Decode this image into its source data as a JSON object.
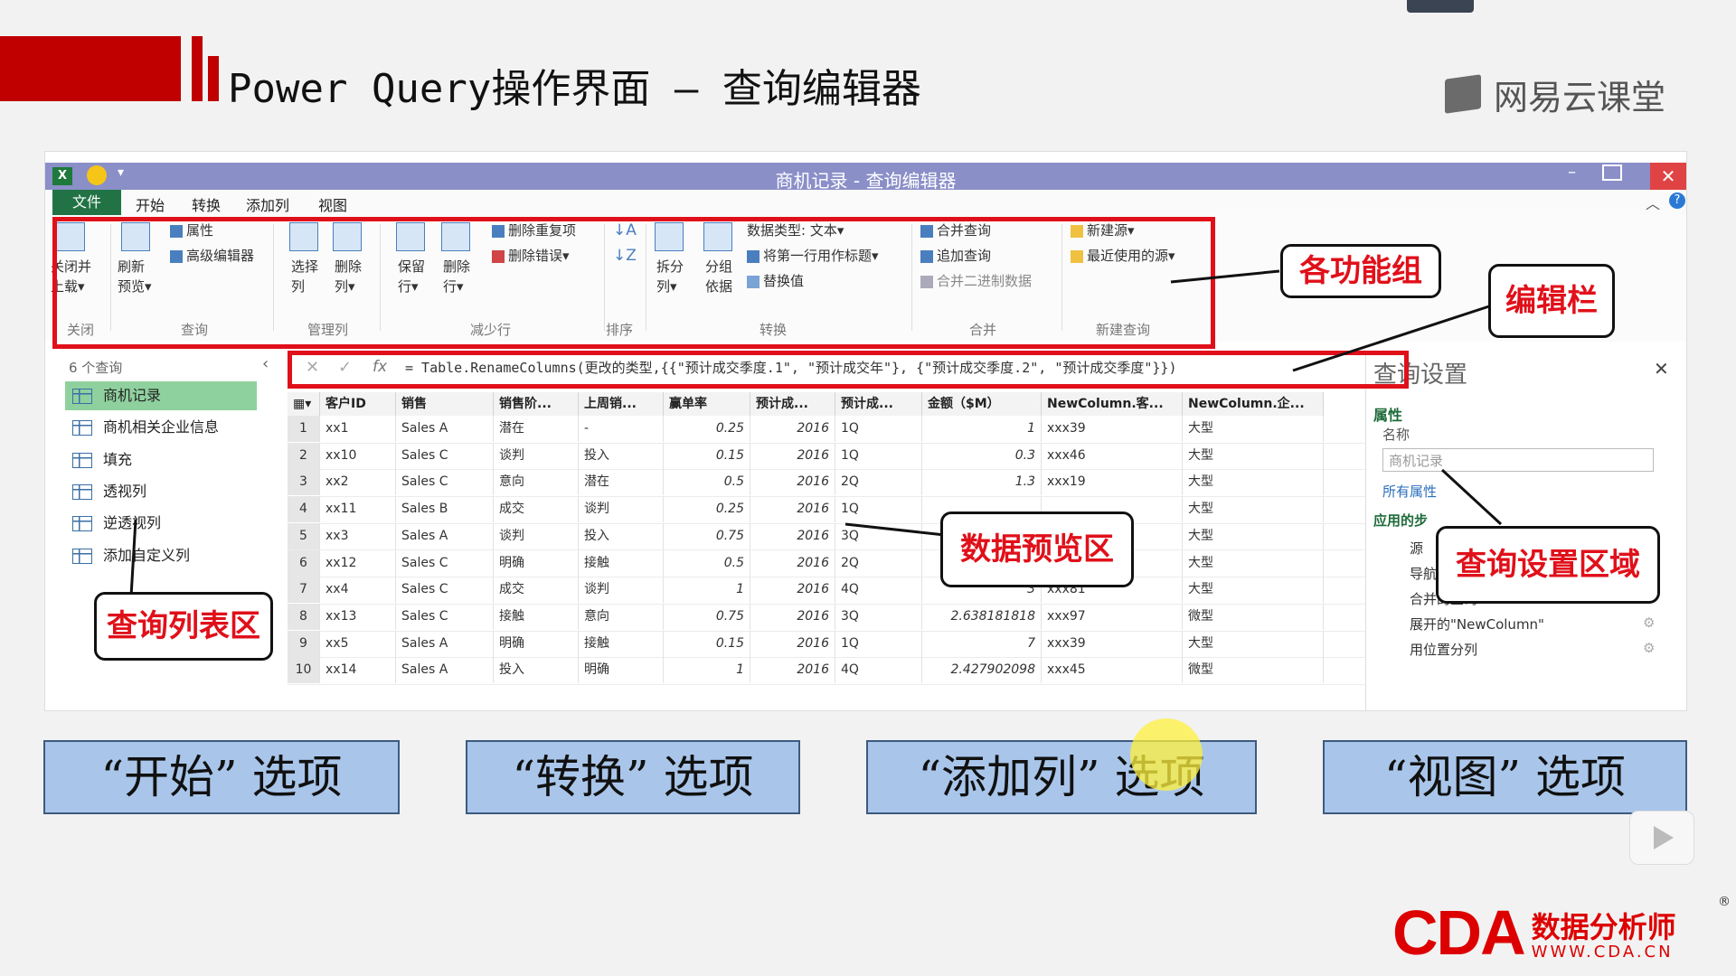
{
  "slide": {
    "title": "Power Query操作界面 – 查询编辑器",
    "brand": "网易云课堂",
    "footer_logo": "CDA",
    "footer_cn": "数据分析师",
    "footer_url": "WWW.CDA.CN",
    "registered": "®"
  },
  "window": {
    "title": "商机记录 - 查询编辑器",
    "xl_icon": "X",
    "min": "–",
    "close": "✕"
  },
  "menu": {
    "file": "文件",
    "items": [
      "开始",
      "转换",
      "添加列",
      "视图"
    ]
  },
  "ribbon": {
    "close_load": "关闭并",
    "close_load2": "上载▾",
    "refresh": "刷新",
    "refresh2": "预览▾",
    "properties": "属性",
    "advanced_editor": "高级编辑器",
    "choose_cols": "选择",
    "choose_cols2": "列",
    "remove_cols": "删除",
    "remove_cols2": "列▾",
    "keep_rows": "保留",
    "keep_rows2": "行▾",
    "remove_rows": "删除",
    "remove_rows2": "行▾",
    "remove_dup": "删除重复项",
    "remove_err": "删除错误▾",
    "split_col": "拆分",
    "split_col2": "列▾",
    "group_by": "分组",
    "group_by2": "依据",
    "data_type": "数据类型: 文本▾",
    "first_row_header": "将第一行用作标题▾",
    "replace": "替换值",
    "merge_queries": "合并查询",
    "append_queries": "追加查询",
    "combine_binaries": "合并二进制数据",
    "new_source": "新建源▾",
    "recent_sources": "最近使用的源▾",
    "groups": [
      "关闭",
      "查询",
      "管理列",
      "减少行",
      "排序",
      "转换",
      "合并",
      "新建查询"
    ]
  },
  "queries": {
    "count": "6 个查询",
    "collapse": "‹",
    "items": [
      "商机记录",
      "商机相关企业信息",
      "填充",
      "透视列",
      "逆透视列",
      "添加自定义列"
    ]
  },
  "formula": {
    "cancel": "✕",
    "confirm": "✓",
    "fx": "fx",
    "text": "= Table.RenameColumns(更改的类型,{{\"预计成交季度.1\", \"预计成交年\"}, {\"预计成交季度.2\", \"预计成交季度\"}})"
  },
  "grid": {
    "headers": [
      "客户ID",
      "销售",
      "销售阶...",
      "上周销...",
      "赢单率",
      "预计成...",
      "预计成...",
      "金额（$M）",
      "NewColumn.客...",
      "NewColumn.企..."
    ],
    "rows": [
      [
        "1",
        "xx1",
        "Sales A",
        "潜在",
        "-",
        "0.25",
        "2016",
        "1Q",
        "1",
        "xxx39",
        "大型"
      ],
      [
        "2",
        "xx10",
        "Sales C",
        "谈判",
        "投入",
        "0.15",
        "2016",
        "1Q",
        "0.3",
        "xxx46",
        "大型"
      ],
      [
        "3",
        "xx2",
        "Sales C",
        "意向",
        "潜在",
        "0.5",
        "2016",
        "2Q",
        "1.3",
        "xxx19",
        "大型"
      ],
      [
        "4",
        "xx11",
        "Sales B",
        "成交",
        "谈判",
        "0.25",
        "2016",
        "1Q",
        "",
        "",
        "大型"
      ],
      [
        "5",
        "xx3",
        "Sales A",
        "谈判",
        "投入",
        "0.75",
        "2016",
        "3Q",
        "",
        "",
        "大型"
      ],
      [
        "6",
        "xx12",
        "Sales C",
        "明确",
        "接触",
        "0.5",
        "2016",
        "2Q",
        "",
        "",
        "大型"
      ],
      [
        "7",
        "xx4",
        "Sales C",
        "成交",
        "谈判",
        "1",
        "2016",
        "4Q",
        "3",
        "xxx81",
        "大型"
      ],
      [
        "8",
        "xx13",
        "Sales C",
        "接触",
        "意向",
        "0.75",
        "2016",
        "3Q",
        "2.638181818",
        "xxx97",
        "微型"
      ],
      [
        "9",
        "xx5",
        "Sales A",
        "明确",
        "接触",
        "0.15",
        "2016",
        "1Q",
        "7",
        "xxx39",
        "大型"
      ],
      [
        "10",
        "xx14",
        "Sales A",
        "投入",
        "明确",
        "1",
        "2016",
        "4Q",
        "2.427902098",
        "xxx45",
        "微型"
      ]
    ]
  },
  "settings": {
    "title": "查询设置",
    "close": "✕",
    "properties": "属性",
    "name_label": "名称",
    "name_value": "商机记录",
    "all_properties": "所有属性",
    "applied_steps": "应用的步",
    "steps": [
      "源",
      "导航",
      "合并的查询",
      "展开的\"NewColumn\"",
      "用位置分列"
    ]
  },
  "callouts": {
    "ribbon": "各功能组",
    "formula": "编辑栏",
    "preview": "数据预览区",
    "settings": "查询设置区域",
    "queries": "查询列表区"
  },
  "buttons": [
    "“开始” 选项",
    "“转换” 选项",
    "“添加列” 选项",
    "“视图” 选项"
  ],
  "colors": {
    "accent_red": "#e0101a",
    "excel_green": "#217346",
    "button_blue": "#a9c6ea"
  }
}
